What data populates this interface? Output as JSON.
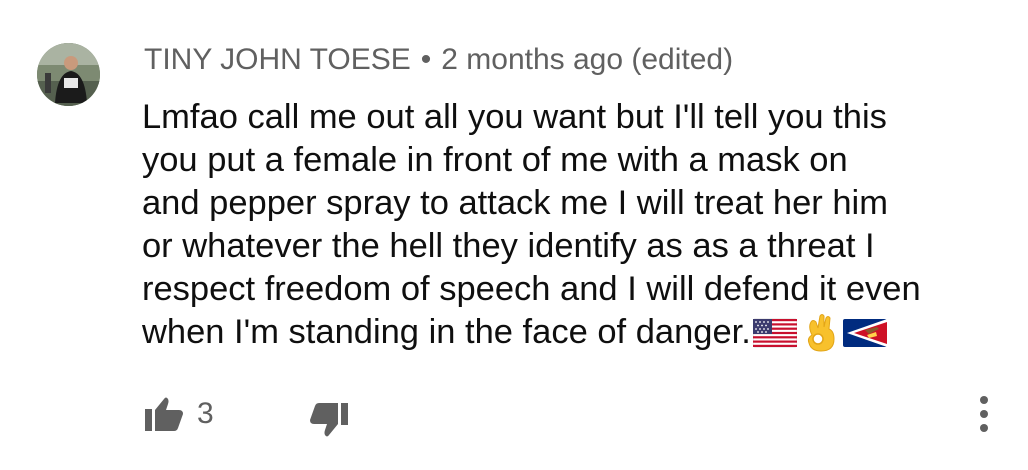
{
  "comment": {
    "author": "TINY JOHN TOESE",
    "separator": "•",
    "timestamp": "2 months ago (edited)",
    "text_lines": [
      "Lmfao call me out all you want but I'll tell you this",
      "you put a female in front of me with a mask on",
      "and pepper spray to attack me I will treat her him",
      "or whatever the hell they identify as as a threat I",
      "respect freedom of speech and I will defend it even",
      "when I'm standing in the face of danger."
    ],
    "emojis": [
      "us-flag-emoji",
      "ok-hand-emoji",
      "american-samoa-flag-emoji"
    ]
  },
  "actions": {
    "like_count": "3",
    "like_icon": "thumbs-up-icon",
    "dislike_icon": "thumbs-down-icon",
    "more_icon": "more-vertical-icon"
  },
  "colors": {
    "secondary_text": "#606060",
    "primary_text": "#0f0f0f",
    "icon": "#606060"
  }
}
